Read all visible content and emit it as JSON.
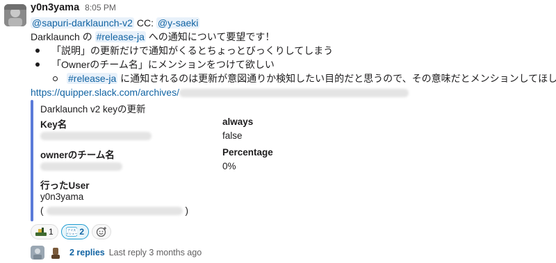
{
  "message": {
    "username": "y0n3yama",
    "timestamp": "8:05 PM",
    "mention_main": "@sapuri-darklaunch-v2",
    "cc_label": "CC:",
    "mention_cc": "@y-saeki",
    "intro_prefix": "Darklaunch の",
    "intro_channel": "#release-ja",
    "intro_suffix": "への通知について要望です！",
    "bullets": [
      "「説明」の更新だけで通知がくるとちょっとびっくりしてしまう",
      "「Ownerのチーム名」にメンションをつけて欲しい"
    ],
    "sub_bullet_channel": "#release-ja",
    "sub_bullet_text": "に通知されるのは更新が意図通りか検知したい目的だと思うので、その意味だとメンションしてほしい",
    "link_text": "https://quipper.slack.com/archives/"
  },
  "attachment": {
    "title": "Darklaunch v2 keyの更新",
    "fields": [
      {
        "label": "Key名",
        "value": ""
      },
      {
        "label": "always",
        "value": "false"
      },
      {
        "label": "ownerのチーム名",
        "value": ""
      },
      {
        "label": "Percentage",
        "value": "0%"
      },
      {
        "label": "行ったUser",
        "value": "y0n3yama"
      }
    ],
    "user_paren_open": "(",
    "user_paren_close": ")"
  },
  "reactions": [
    {
      "emoji": "ship-emoji",
      "count": "1"
    },
    {
      "emoji": "nice-issue-emoji",
      "count": "2",
      "emoji_text_1": "ナイス",
      "emoji_text_2": "イシュー"
    }
  ],
  "thread": {
    "replies": "2 replies",
    "last_reply": "Last reply 3 months ago"
  },
  "colors": {
    "accent_bar": "#5b7bd9",
    "mention_bg": "#e8f1fa",
    "link": "#1264a3"
  }
}
